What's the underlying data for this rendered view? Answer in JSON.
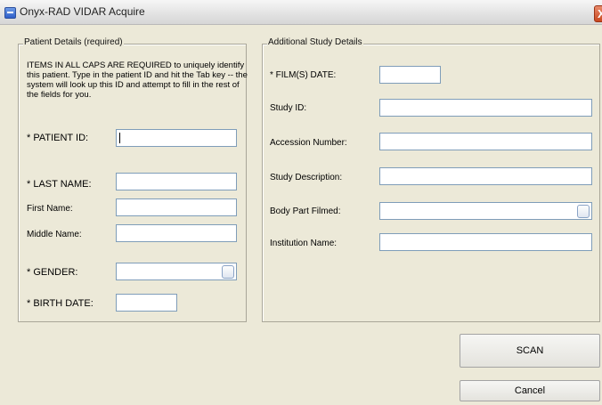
{
  "window": {
    "title": "Onyx-RAD VIDAR Acquire",
    "close_glyph": "X"
  },
  "patient": {
    "legend": "Patient Details (required)",
    "instructions": "ITEMS IN ALL CAPS ARE REQUIRED to uniquely identify this patient.  Type in the patient ID and hit the Tab key -- the system will look up this ID and attempt to fill in the rest of the fields for you.",
    "patient_id_label": "* PATIENT ID:",
    "patient_id_value": "",
    "last_name_label": "* LAST NAME:",
    "first_name_label": "First Name:",
    "middle_name_label": "Middle Name:",
    "gender_label": "* GENDER:",
    "birth_date_label": "* BIRTH DATE:"
  },
  "study": {
    "legend": "Additional Study Details",
    "film_date_label": "* FILM(S) DATE:",
    "study_id_label": "Study ID:",
    "accession_label": "Accession Number:",
    "description_label": "Study Description:",
    "body_part_label": "Body Part Filmed:",
    "institution_label": "Institution Name:"
  },
  "buttons": {
    "scan": "SCAN",
    "cancel": "Cancel"
  },
  "colors": {
    "window_bg": "#ece9d8",
    "border": "#a9a698",
    "input_border": "#7f9db9",
    "close_red": "#c8471f"
  },
  "icons": {
    "system_menu": "system-menu-icon",
    "close": "close-icon",
    "dropdown": "dropdown-arrow-icon"
  }
}
